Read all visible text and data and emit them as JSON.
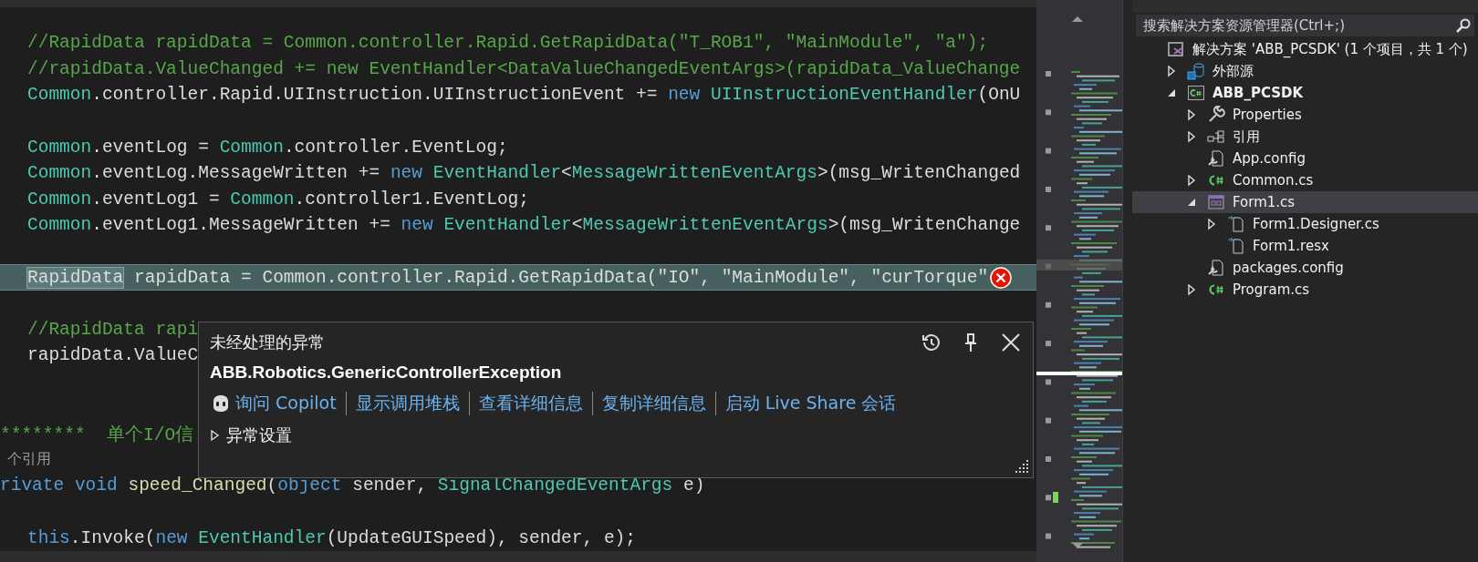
{
  "editor": {
    "lines": [
      {
        "kind": "body",
        "highlighted": false,
        "error": false,
        "tokens": [
          {
            "kind": "comment",
            "text": "//RapidData rapidData = Common.controller.Rapid.GetRapidData(\"T_ROB1\", \"MainModule\", \"a\");"
          }
        ]
      },
      {
        "kind": "body",
        "highlighted": false,
        "error": false,
        "tokens": [
          {
            "kind": "comment",
            "text": "//rapidData.ValueChanged += new EventHandler<DataValueChangedEventArgs>(rapidData_ValueChange"
          }
        ]
      },
      {
        "kind": "body",
        "highlighted": false,
        "error": false,
        "tokens": [
          {
            "kind": "type",
            "text": "Common"
          },
          {
            "kind": "plain",
            "text": ".controller.Rapid.UIInstruction.UIInstructionEvent += "
          },
          {
            "kind": "keyword",
            "text": "new"
          },
          {
            "kind": "type",
            "text": " UIInstructionEventHandler"
          },
          {
            "kind": "plain",
            "text": "(OnU"
          }
        ]
      },
      {
        "kind": "blank"
      },
      {
        "kind": "body",
        "highlighted": false,
        "error": false,
        "tokens": [
          {
            "kind": "type",
            "text": "Common"
          },
          {
            "kind": "plain",
            "text": ".eventLog = "
          },
          {
            "kind": "type",
            "text": "Common"
          },
          {
            "kind": "plain",
            "text": ".controller.EventLog;"
          }
        ]
      },
      {
        "kind": "body",
        "highlighted": false,
        "error": false,
        "tokens": [
          {
            "kind": "type",
            "text": "Common"
          },
          {
            "kind": "plain",
            "text": ".eventLog.MessageWritten += "
          },
          {
            "kind": "keyword",
            "text": "new"
          },
          {
            "kind": "type",
            "text": " EventHandler"
          },
          {
            "kind": "plain",
            "text": "<"
          },
          {
            "kind": "type",
            "text": "MessageWrittenEventArgs"
          },
          {
            "kind": "plain",
            "text": ">(msg_WritenChanged"
          }
        ]
      },
      {
        "kind": "body",
        "highlighted": false,
        "error": false,
        "tokens": [
          {
            "kind": "type",
            "text": "Common"
          },
          {
            "kind": "plain",
            "text": ".eventLog1 = "
          },
          {
            "kind": "type",
            "text": "Common"
          },
          {
            "kind": "plain",
            "text": ".controller1.EventLog;"
          }
        ]
      },
      {
        "kind": "body",
        "highlighted": false,
        "error": false,
        "tokens": [
          {
            "kind": "type",
            "text": "Common"
          },
          {
            "kind": "plain",
            "text": ".eventLog1.MessageWritten += "
          },
          {
            "kind": "keyword",
            "text": "new"
          },
          {
            "kind": "type",
            "text": " EventHandler"
          },
          {
            "kind": "plain",
            "text": "<"
          },
          {
            "kind": "type",
            "text": "MessageWrittenEventArgs"
          },
          {
            "kind": "plain",
            "text": ">(msg_WritenChange"
          }
        ]
      },
      {
        "kind": "blank"
      },
      {
        "kind": "body",
        "highlighted": true,
        "error": true,
        "tokens": [
          {
            "kind": "match",
            "text": "RapidData"
          },
          {
            "kind": "plain",
            "text": " rapidData = Common.controller.Rapid.GetRapidData(\"IO\", \"MainModule\", \"curTorque\""
          }
        ]
      },
      {
        "kind": "blank"
      },
      {
        "kind": "body",
        "highlighted": false,
        "error": false,
        "tokens": [
          {
            "kind": "comment",
            "text": "//RapidData rapi"
          }
        ]
      },
      {
        "kind": "body",
        "highlighted": false,
        "error": false,
        "tokens": [
          {
            "kind": "plain",
            "text": "rapidData.ValueC"
          }
        ]
      },
      {
        "kind": "blank"
      },
      {
        "kind": "blank"
      },
      {
        "kind": "member",
        "highlighted": false,
        "error": false,
        "tokens": [
          {
            "kind": "comment",
            "text": "********  单个I/O信"
          }
        ]
      },
      {
        "kind": "codelens",
        "text": "个引用"
      },
      {
        "kind": "member",
        "highlighted": false,
        "error": false,
        "tokens": [
          {
            "kind": "keyword",
            "text": "rivate"
          },
          {
            "kind": "keyword",
            "text": " void"
          },
          {
            "kind": "method",
            "text": " speed_Changed"
          },
          {
            "kind": "plain",
            "text": "("
          },
          {
            "kind": "keyword",
            "text": "object"
          },
          {
            "kind": "plain",
            "text": " sender, "
          },
          {
            "kind": "type",
            "text": "SignalChangedEventArgs"
          },
          {
            "kind": "plain",
            "text": " e)"
          }
        ]
      },
      {
        "kind": "blank"
      },
      {
        "kind": "body",
        "highlighted": false,
        "error": false,
        "tokens": [
          {
            "kind": "keyword",
            "text": "this"
          },
          {
            "kind": "plain",
            "text": ".Invoke("
          },
          {
            "kind": "keyword",
            "text": "new"
          },
          {
            "kind": "type",
            "text": " EventHandler"
          },
          {
            "kind": "plain",
            "text": "(UpdateGUISpeed), sender, e);"
          }
        ]
      }
    ]
  },
  "exception_popup": {
    "title": "未经处理的异常",
    "exception": "ABB.Robotics.GenericControllerException",
    "actions": [
      {
        "kind": "copilot",
        "label": "询问 Copilot"
      },
      {
        "kind": "link",
        "label": "显示调用堆栈"
      },
      {
        "kind": "link",
        "label": "查看详细信息"
      },
      {
        "kind": "link",
        "label": "复制详细信息"
      },
      {
        "kind": "link",
        "label": "启动 Live Share 会话"
      }
    ],
    "settings": {
      "label": "异常设置",
      "expanded": false
    }
  },
  "solution_explorer": {
    "search": {
      "placeholder": "搜索解决方案资源管理器(Ctrl+;)"
    },
    "tree": [
      {
        "kind": "solution",
        "label": "解决方案 'ABB_PCSDK' (1 个项目，共 1 个)",
        "selected": false,
        "children": [
          {
            "kind": "external",
            "label": "外部源",
            "expanded": false,
            "selected": false
          },
          {
            "kind": "project",
            "label": "ABB_PCSDK",
            "expanded": true,
            "selected": false,
            "children": [
              {
                "kind": "properties",
                "label": "Properties",
                "expanded": false,
                "selected": false
              },
              {
                "kind": "references",
                "label": "引用",
                "expanded": false,
                "selected": false
              },
              {
                "kind": "config",
                "label": "App.config",
                "selected": false
              },
              {
                "kind": "csharp",
                "label": "Common.cs",
                "expanded": false,
                "selected": false
              },
              {
                "kind": "form",
                "label": "Form1.cs",
                "expanded": true,
                "selected": true,
                "children": [
                  {
                    "kind": "linked-file",
                    "label": "Form1.Designer.cs",
                    "expanded": false,
                    "selected": false
                  },
                  {
                    "kind": "linked-file",
                    "label": "Form1.resx",
                    "selected": false
                  }
                ]
              },
              {
                "kind": "config",
                "label": "packages.config",
                "selected": false
              },
              {
                "kind": "csharp",
                "label": "Program.cs",
                "expanded": false,
                "selected": false
              }
            ]
          }
        ]
      }
    ]
  }
}
